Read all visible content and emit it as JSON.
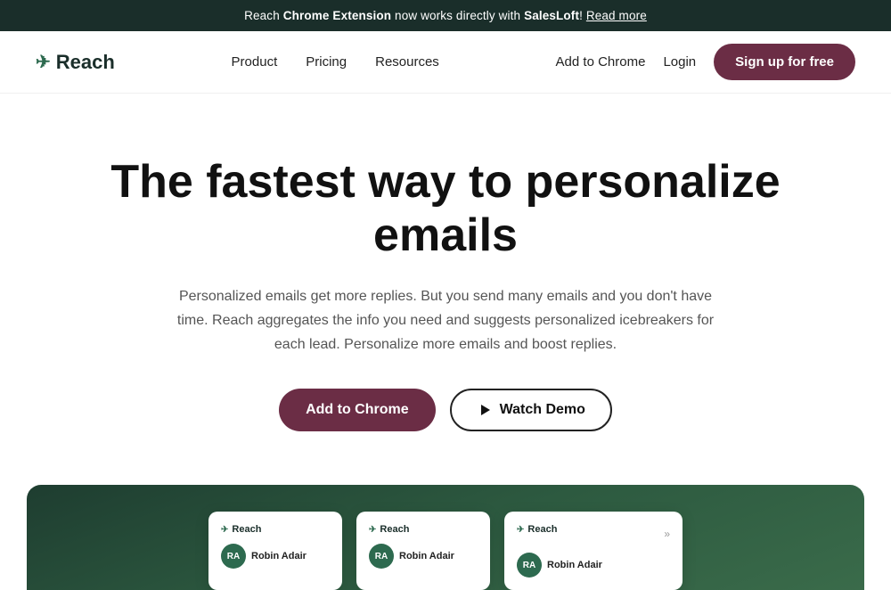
{
  "banner": {
    "prefix": "Reach ",
    "bold1": "Chrome Extension",
    "middle": " now works directly with ",
    "bold2": "SalesLoft",
    "suffix": "! ",
    "link_text": "Read more"
  },
  "nav": {
    "logo_text": "Reach",
    "logo_icon": "✈",
    "links": [
      {
        "label": "Product",
        "href": "#"
      },
      {
        "label": "Pricing",
        "href": "#"
      },
      {
        "label": "Resources",
        "href": "#"
      }
    ],
    "add_chrome": "Add to Chrome",
    "login": "Login",
    "signup": "Sign up for free"
  },
  "hero": {
    "headline_line1": "The fastest way to personalize",
    "headline_line2": "emails",
    "subtext": "Personalized emails get more replies. But you send many emails and you don't have time. Reach aggregates the info you need and suggests personalized icebreakers for each lead. Personalize more emails and boost replies.",
    "btn_chrome": "Add to Chrome",
    "btn_demo": "Watch Demo"
  },
  "preview": {
    "cards": [
      {
        "id": 1,
        "name": "Robin Adair",
        "initials": "RA"
      },
      {
        "id": 2,
        "name": "Robin Adair",
        "initials": "RA"
      },
      {
        "id": 3,
        "name": "Robin Adair",
        "initials": "RA"
      }
    ]
  }
}
